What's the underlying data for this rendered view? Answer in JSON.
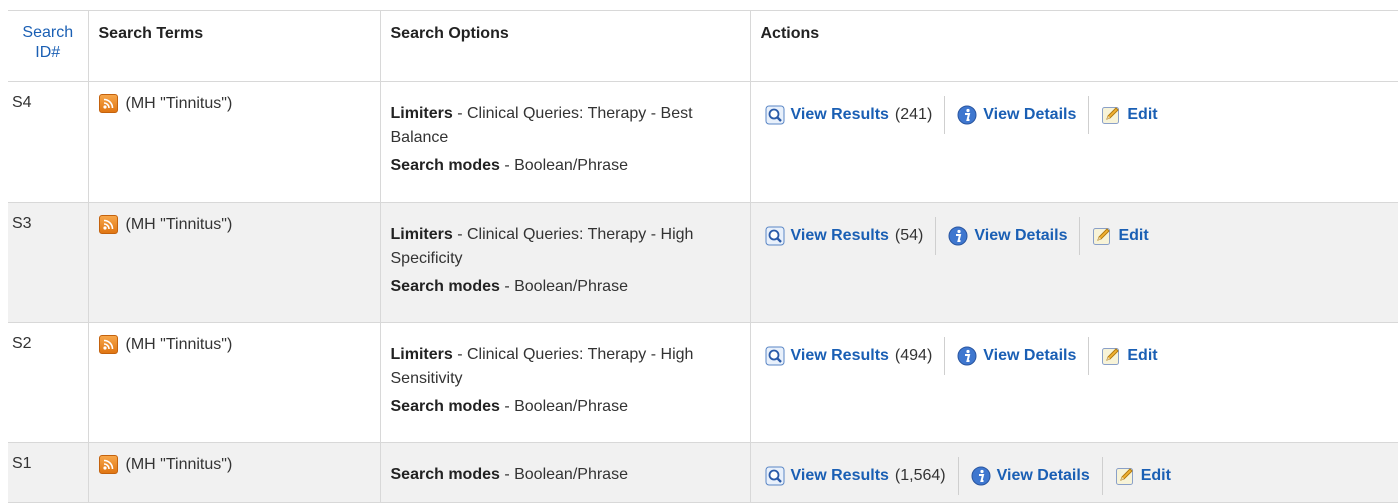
{
  "columns": {
    "search_id": "Search ID#",
    "search_terms": "Search Terms",
    "search_options": "Search Options",
    "actions": "Actions"
  },
  "labels": {
    "limiters": "Limiters",
    "search_modes": "Search modes",
    "view_results": "View Results",
    "view_details": "View Details",
    "edit": "Edit"
  },
  "icons": {
    "rss": "rss-feed-icon",
    "view_results": "magnifier-icon",
    "view_details": "info-icon",
    "edit": "edit-pencil-icon"
  },
  "rows": [
    {
      "id": "S4",
      "terms": "(MH \"Tinnitus\")",
      "limiters": " - Clinical Queries: Therapy - Best Balance",
      "search_modes": " - Boolean/Phrase",
      "result_count": "(241)"
    },
    {
      "id": "S3",
      "terms": "(MH \"Tinnitus\")",
      "limiters": " - Clinical Queries: Therapy - High Specificity",
      "search_modes": " - Boolean/Phrase",
      "result_count": "(54)"
    },
    {
      "id": "S2",
      "terms": "(MH \"Tinnitus\")",
      "limiters": " - Clinical Queries: Therapy - High Sensitivity",
      "search_modes": " - Boolean/Phrase",
      "result_count": "(494)"
    },
    {
      "id": "S1",
      "terms": "(MH \"Tinnitus\")",
      "search_modes": " - Boolean/Phrase",
      "result_count": "(1,564)"
    }
  ]
}
